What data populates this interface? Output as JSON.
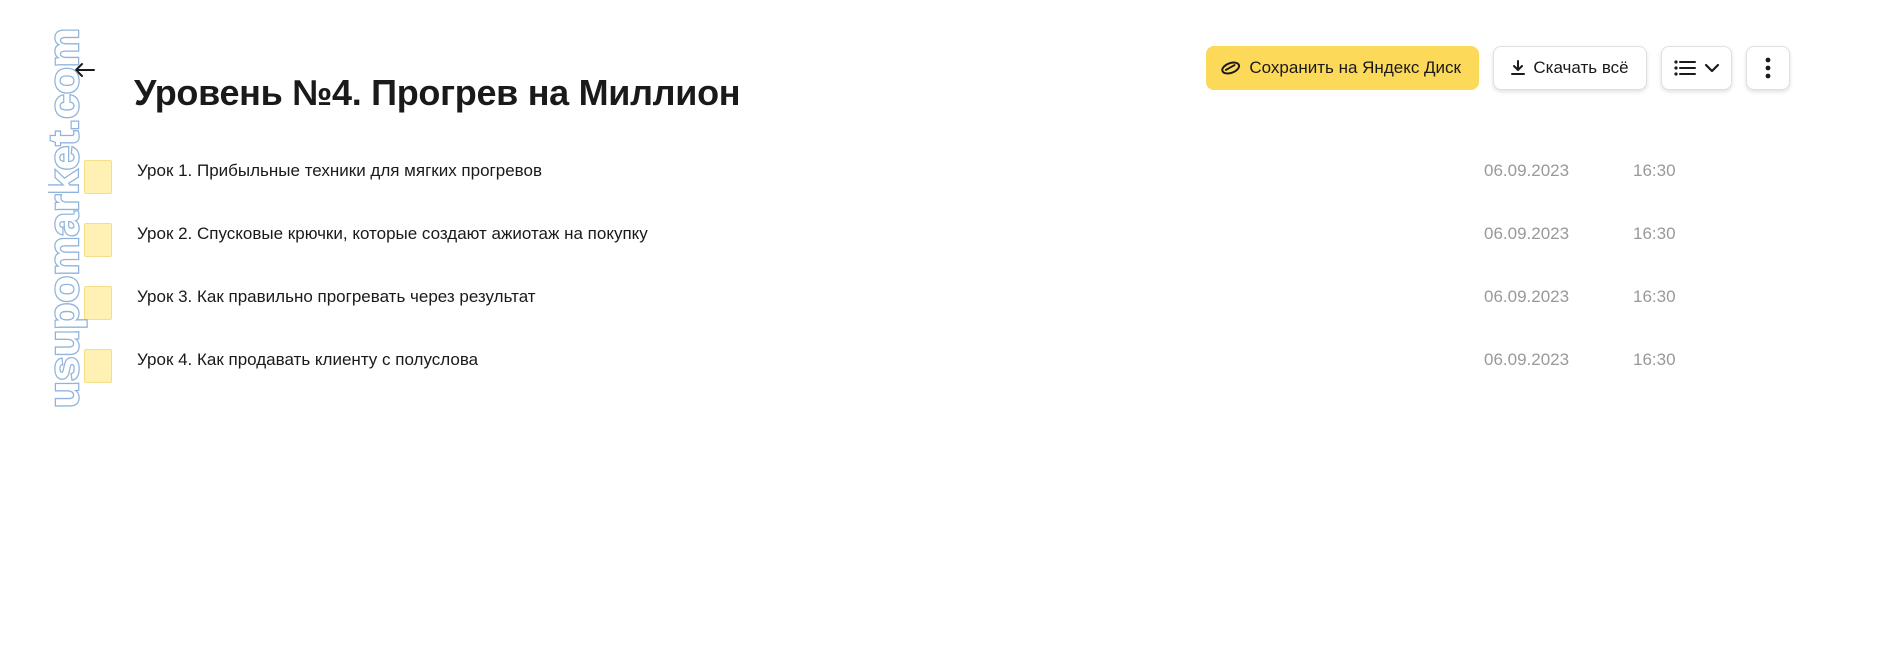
{
  "header": {
    "title": "Уровень №4. Прогрев на Миллион"
  },
  "toolbar": {
    "save_label": "Сохранить на Яндекс Диск",
    "download_label": "Скачать всё",
    "save_color": "#fcd959"
  },
  "files": [
    {
      "name": "Урок 1. Прибыльные техники для мягких прогревов",
      "date": "06.09.2023",
      "time": "16:30"
    },
    {
      "name": "Урок 2. Спусковые крючки, которые создают ажиотаж на покупку",
      "date": "06.09.2023",
      "time": "16:30"
    },
    {
      "name": "Урок 3. Как правильно прогревать через результат",
      "date": "06.09.2023",
      "time": "16:30"
    },
    {
      "name": "Урок 4. Как продавать клиенту с полуслова",
      "date": "06.09.2023",
      "time": "16:30"
    }
  ],
  "watermark": {
    "text": "usupomarket.com"
  },
  "icons": {
    "back": "arrow-left-icon",
    "save": "disk-icon",
    "download": "download-icon",
    "view": "list-view-icon",
    "chevron": "chevron-down-icon",
    "more": "more-vertical-icon"
  }
}
